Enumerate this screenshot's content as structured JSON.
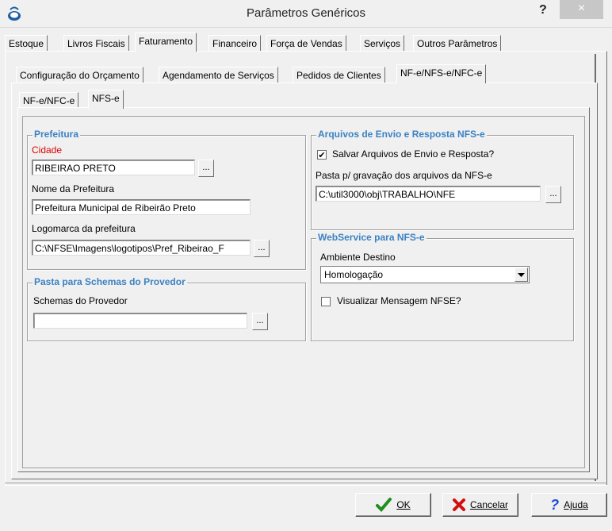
{
  "window": {
    "title": "Parâmetros Genéricos",
    "help_glyph": "?",
    "close_glyph": "×"
  },
  "tabs_main": [
    {
      "label": "Estoque"
    },
    {
      "label": "Livros Fiscais"
    },
    {
      "label": "Faturamento"
    },
    {
      "label": "Financeiro"
    },
    {
      "label": "Força de Vendas"
    },
    {
      "label": "Serviços"
    },
    {
      "label": "Outros Parâmetros"
    }
  ],
  "tabs_sub": [
    {
      "label": "Configuração do Orçamento"
    },
    {
      "label": "Agendamento de Serviços"
    },
    {
      "label": "Pedidos de Clientes"
    },
    {
      "label": "NF-e/NFS-e/NFC-e"
    }
  ],
  "tabs_sub2": [
    {
      "label": "NF-e/NFC-e"
    },
    {
      "label": "NFS-e"
    }
  ],
  "prefeitura": {
    "title": "Prefeitura",
    "cidade_label": "Cidade",
    "cidade_value": "RIBEIRAO PRETO",
    "nome_label": "Nome da Prefeitura",
    "nome_value": "Prefeitura Municipal de Ribeirão Preto",
    "logo_label": "Logomarca da prefeitura",
    "logo_value": "C:\\NFSE\\Imagens\\logotipos\\Pref_Ribeirao_F",
    "dots": "..."
  },
  "schemas": {
    "title": "Pasta para Schemas do Provedor",
    "label": "Schemas do Provedor",
    "value": "",
    "dots": "..."
  },
  "arquivos": {
    "title": "Arquivos de Envio e Resposta NFS-e",
    "salvar_label": "Salvar Arquivos de Envio e Resposta?",
    "salvar_checked": "✔",
    "pasta_label": "Pasta p/ gravação dos arquivos da NFS-e",
    "pasta_value": "C:\\util3000\\obj\\TRABALHO\\NFE",
    "dots": "..."
  },
  "webservice": {
    "title": "WebService para NFS-e",
    "ambiente_label": "Ambiente Destino",
    "ambiente_value": "Homologação",
    "visualizar_label": "Visualizar Mensagem NFSE?"
  },
  "buttons": {
    "ok": "OK",
    "cancelar": "Cancelar",
    "ajuda": "Ajuda"
  },
  "colors": {
    "required_label": "#e00000",
    "group_title": "#3b82c4"
  }
}
